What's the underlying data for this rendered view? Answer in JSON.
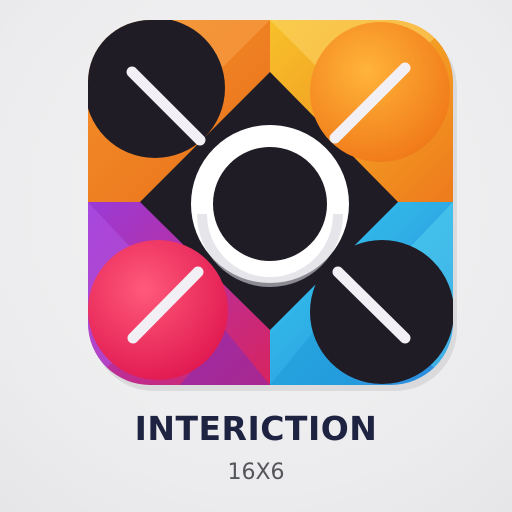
{
  "app": {
    "name": "INTERICTION",
    "subtitle": "16X6"
  },
  "icon": {
    "name": "app-logo-icon",
    "colors": {
      "orange": "#f08a1a",
      "yellow": "#f5b21f",
      "purple": "#8a3ad0",
      "magenta": "#e8265a",
      "cyan": "#2cc6e6",
      "blue": "#2a8fe0",
      "dark": "#1f1c26",
      "white": "#ffffff",
      "stroke": "#f2f0f4"
    }
  }
}
